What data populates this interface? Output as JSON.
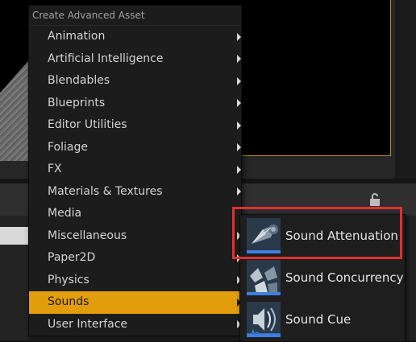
{
  "menu": {
    "header": "Create Advanced Asset",
    "items": [
      {
        "label": "Animation"
      },
      {
        "label": "Artificial Intelligence"
      },
      {
        "label": "Blendables"
      },
      {
        "label": "Blueprints"
      },
      {
        "label": "Editor Utilities"
      },
      {
        "label": "Foliage"
      },
      {
        "label": "FX"
      },
      {
        "label": "Materials & Textures"
      },
      {
        "label": "Media"
      },
      {
        "label": "Miscellaneous"
      },
      {
        "label": "Paper2D"
      },
      {
        "label": "Physics"
      },
      {
        "label": "Sounds"
      },
      {
        "label": "User Interface"
      }
    ],
    "selected": "Sounds",
    "selected_color": "#e29d0c"
  },
  "submenu": {
    "items": [
      {
        "label": "Sound Attenuation",
        "icon": "sound-attenuation-icon"
      },
      {
        "label": "Sound Concurrency",
        "icon": "sound-concurrency-icon"
      },
      {
        "label": "Sound Cue",
        "icon": "sound-cue-icon"
      }
    ],
    "highlight_color": "#e03030",
    "highlighted": "Sound Attenuation"
  },
  "icons": {
    "lock": "lock-open-icon"
  }
}
